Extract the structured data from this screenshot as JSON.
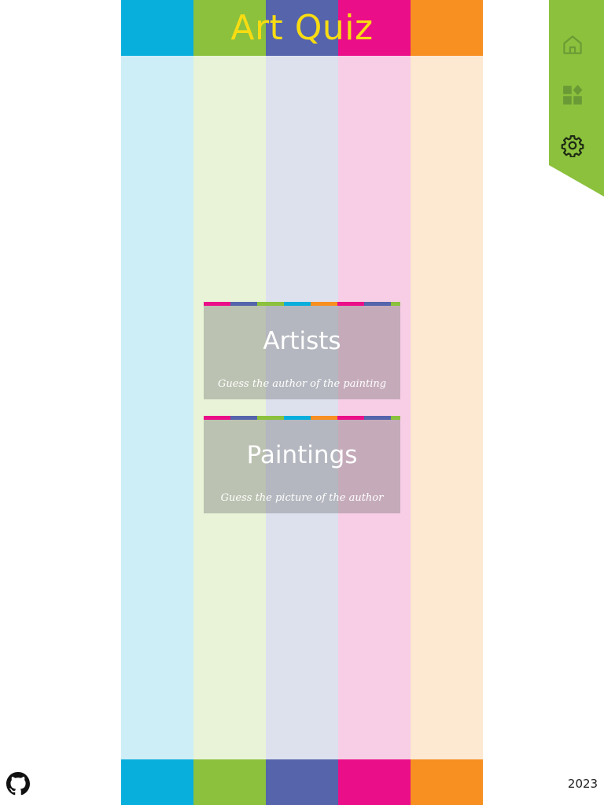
{
  "app": {
    "title": "Art Quiz",
    "year": "2023"
  },
  "colors": {
    "blue": "#08aedc",
    "green": "#8bc13d",
    "purple": "#5564ab",
    "pink": "#ea0e88",
    "orange": "#f78f21",
    "title": "#f8dc12"
  },
  "stripes": [
    {
      "strong": "#08aedc",
      "light": "#cdeef6"
    },
    {
      "strong": "#8bc13d",
      "light": "#e8f3d8"
    },
    {
      "strong": "#5564ab",
      "light": "#dde1ee"
    },
    {
      "strong": "#ea0e88",
      "light": "#f8cde6"
    },
    {
      "strong": "#f78f21",
      "light": "#fde8d2"
    }
  ],
  "side_menu": {
    "items": [
      {
        "name": "home",
        "icon": "home-icon"
      },
      {
        "name": "categories",
        "icon": "categories-icon"
      },
      {
        "name": "settings",
        "icon": "gear-icon"
      }
    ]
  },
  "cards": [
    {
      "title": "Artists",
      "subtitle": "Guess the author of the painting"
    },
    {
      "title": "Paintings",
      "subtitle": "Guess the picture of the author"
    }
  ],
  "footer": {
    "icon": "github-icon"
  }
}
